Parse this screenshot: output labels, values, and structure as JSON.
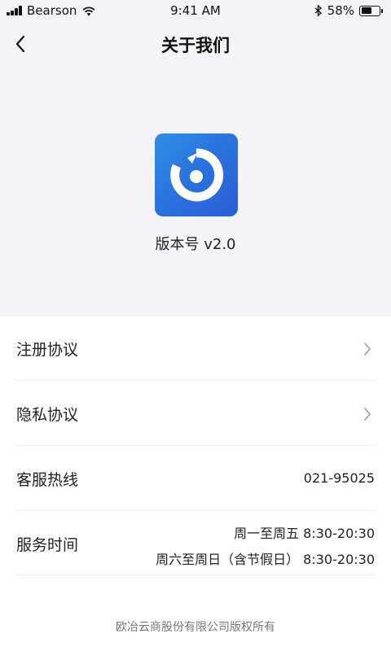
{
  "status_bar": {
    "carrier": "Bearson",
    "time": "9:41 AM",
    "battery_percent": "58%",
    "battery_level": 0.58,
    "icons": [
      "signal-icon",
      "wifi-icon",
      "bluetooth-icon",
      "battery-icon"
    ]
  },
  "nav": {
    "title": "关于我们",
    "back_icon": "chevron-left-icon"
  },
  "app": {
    "icon": "app-logo-icon",
    "version_label": "版本号 v2.0"
  },
  "list": {
    "items": [
      {
        "label": "注册协议",
        "icon": "chevron-right-icon"
      },
      {
        "label": "隐私协议",
        "icon": "chevron-right-icon"
      },
      {
        "label": "客服热线",
        "value": "021-95025"
      },
      {
        "label": "服务时间",
        "lines": [
          "周一至周五  8:30-20:30",
          "周六至周日（含节假日）  8:30-20:30"
        ]
      }
    ]
  },
  "footer": {
    "copyright": "欧冶云商股份有限公司版权所有"
  },
  "colors": {
    "page_background": "#f4f4f8",
    "list_background": "#ffffff",
    "app_icon_start": "#2f8fe6",
    "app_icon_end": "#2a5fd6",
    "divider": "#ececf0",
    "footer_text": "#777777"
  }
}
